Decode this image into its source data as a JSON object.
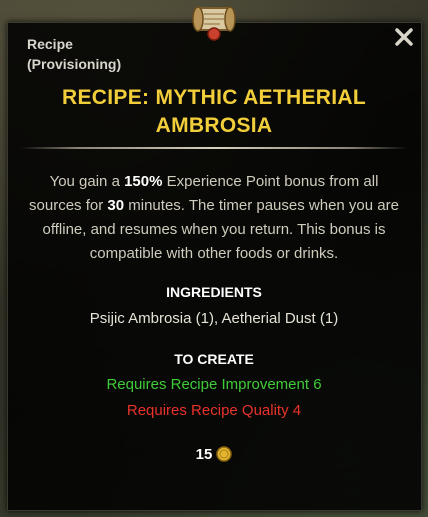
{
  "tooltip": {
    "category_line1": "Recipe",
    "category_line2": "(Provisioning)",
    "title": "RECIPE: MYTHIC AETHERIAL AMBROSIA",
    "description": {
      "p1": "You gain a ",
      "bonus_percent": "150%",
      "p2": " Experience Point bonus from all sources for ",
      "duration": "30",
      "p3": " minutes. The timer pauses when you are offline, and resumes when you return. This bonus is compatible with other foods or drinks."
    },
    "ingredients_header": "INGREDIENTS",
    "ingredients": "Psijic Ambrosia (1), Aetherial Dust (1)",
    "to_create_header": "TO CREATE",
    "requirements": [
      {
        "text": "Requires Recipe Improvement 6",
        "status": "met",
        "color": "#3fcc38"
      },
      {
        "text": "Requires Recipe Quality 4",
        "status": "unmet",
        "color": "#e8322a"
      }
    ],
    "price": "15",
    "icons": {
      "item": "recipe-scroll-icon",
      "close": "close-icon",
      "currency": "gold-coin-icon"
    },
    "colors": {
      "title": "#f2cf3a",
      "text": "#cfcbbd",
      "panel": "#000000"
    }
  }
}
